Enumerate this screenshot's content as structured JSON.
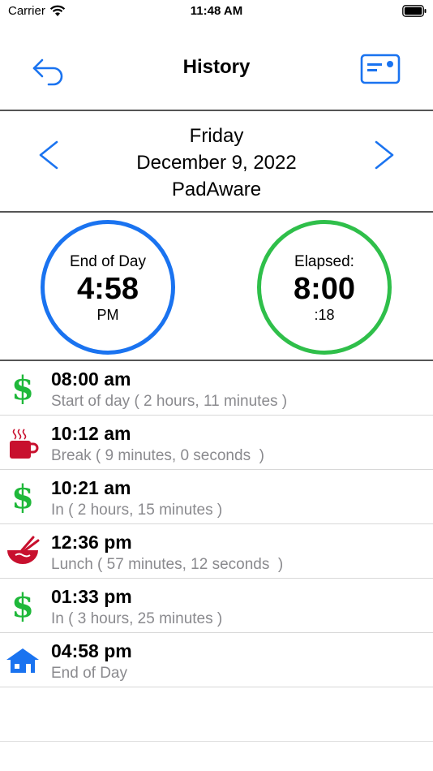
{
  "status_bar": {
    "carrier": "Carrier",
    "time": "11:48 AM"
  },
  "nav": {
    "title": "History",
    "back_icon": "undo-arrow-icon",
    "right_icon": "card-icon",
    "accent": "#1a73f0"
  },
  "date_panel": {
    "weekday": "Friday",
    "date": "December 9, 2022",
    "name": "PadAware"
  },
  "summary": {
    "end_of_day": {
      "label": "End of Day",
      "value": "4:58",
      "sub": "PM",
      "color": "#1a73f0"
    },
    "elapsed": {
      "label": "Elapsed:",
      "value": "8:00",
      "sub": ":18",
      "color": "#2fbf4a"
    }
  },
  "entries": [
    {
      "icon": "dollar-icon",
      "time": "08:00 am",
      "detail": "Start of day ( 2 hours, 11 minutes )"
    },
    {
      "icon": "coffee-cup-icon",
      "time": "10:12 am",
      "detail": "Break ( 9 minutes, 0 seconds  )"
    },
    {
      "icon": "dollar-icon",
      "time": "10:21 am",
      "detail": "In ( 2 hours, 15 minutes )"
    },
    {
      "icon": "noodle-bowl-icon",
      "time": "12:36 pm",
      "detail": "Lunch ( 57 minutes, 12 seconds  )"
    },
    {
      "icon": "dollar-icon",
      "time": "01:33 pm",
      "detail": "In ( 3 hours, 25 minutes )"
    },
    {
      "icon": "house-icon",
      "time": "04:58 pm",
      "detail": "End of Day"
    }
  ],
  "dollar_glyph": "$"
}
